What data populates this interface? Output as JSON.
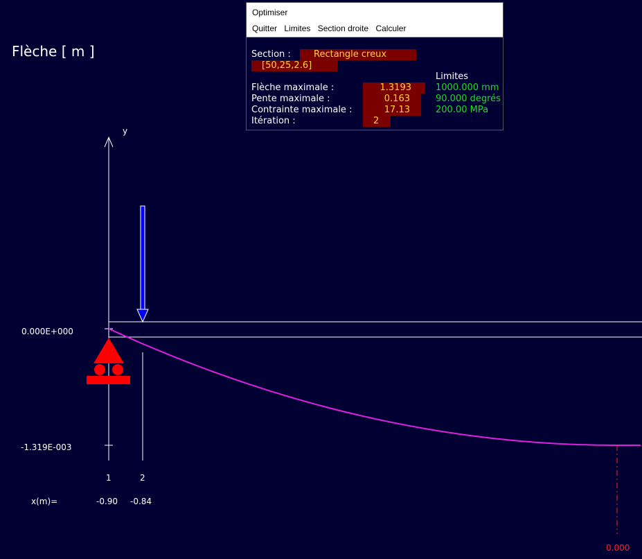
{
  "plot": {
    "title": "Flèche [ m ]",
    "y_axis_label": "y",
    "y_ticks": [
      "0.000E+000",
      "-1.319E-003"
    ],
    "nodes": [
      "1",
      "2"
    ],
    "x_label": "x(m)=",
    "x_values": [
      "-0.90",
      "-0.84"
    ],
    "max_marker_value": "0.000",
    "curve_color": "#e020e0",
    "load_color": "#0000ff",
    "support_color": "#ff0000",
    "max_deflection_fraction": 1.0
  },
  "panel": {
    "title": "Optimiser",
    "menu": [
      "Quitter",
      "Limites",
      "Section droite",
      "Calculer"
    ],
    "section_label": "Section :",
    "section_value": "Rectangle creux",
    "section_dims": "[50,25,2.6]",
    "limits_header": "Limites",
    "rows": [
      {
        "label": "Flèche maximale :",
        "value": "1.3193",
        "limit": "1000.000 mm"
      },
      {
        "label": "Pente maximale :",
        "value": "0.163",
        "limit": "90.000 degrés"
      },
      {
        "label": "Contrainte maximale :",
        "value": "17.13",
        "limit": "200.00 MPa"
      },
      {
        "label": "Itération :",
        "value": "2",
        "limit": ""
      }
    ]
  }
}
